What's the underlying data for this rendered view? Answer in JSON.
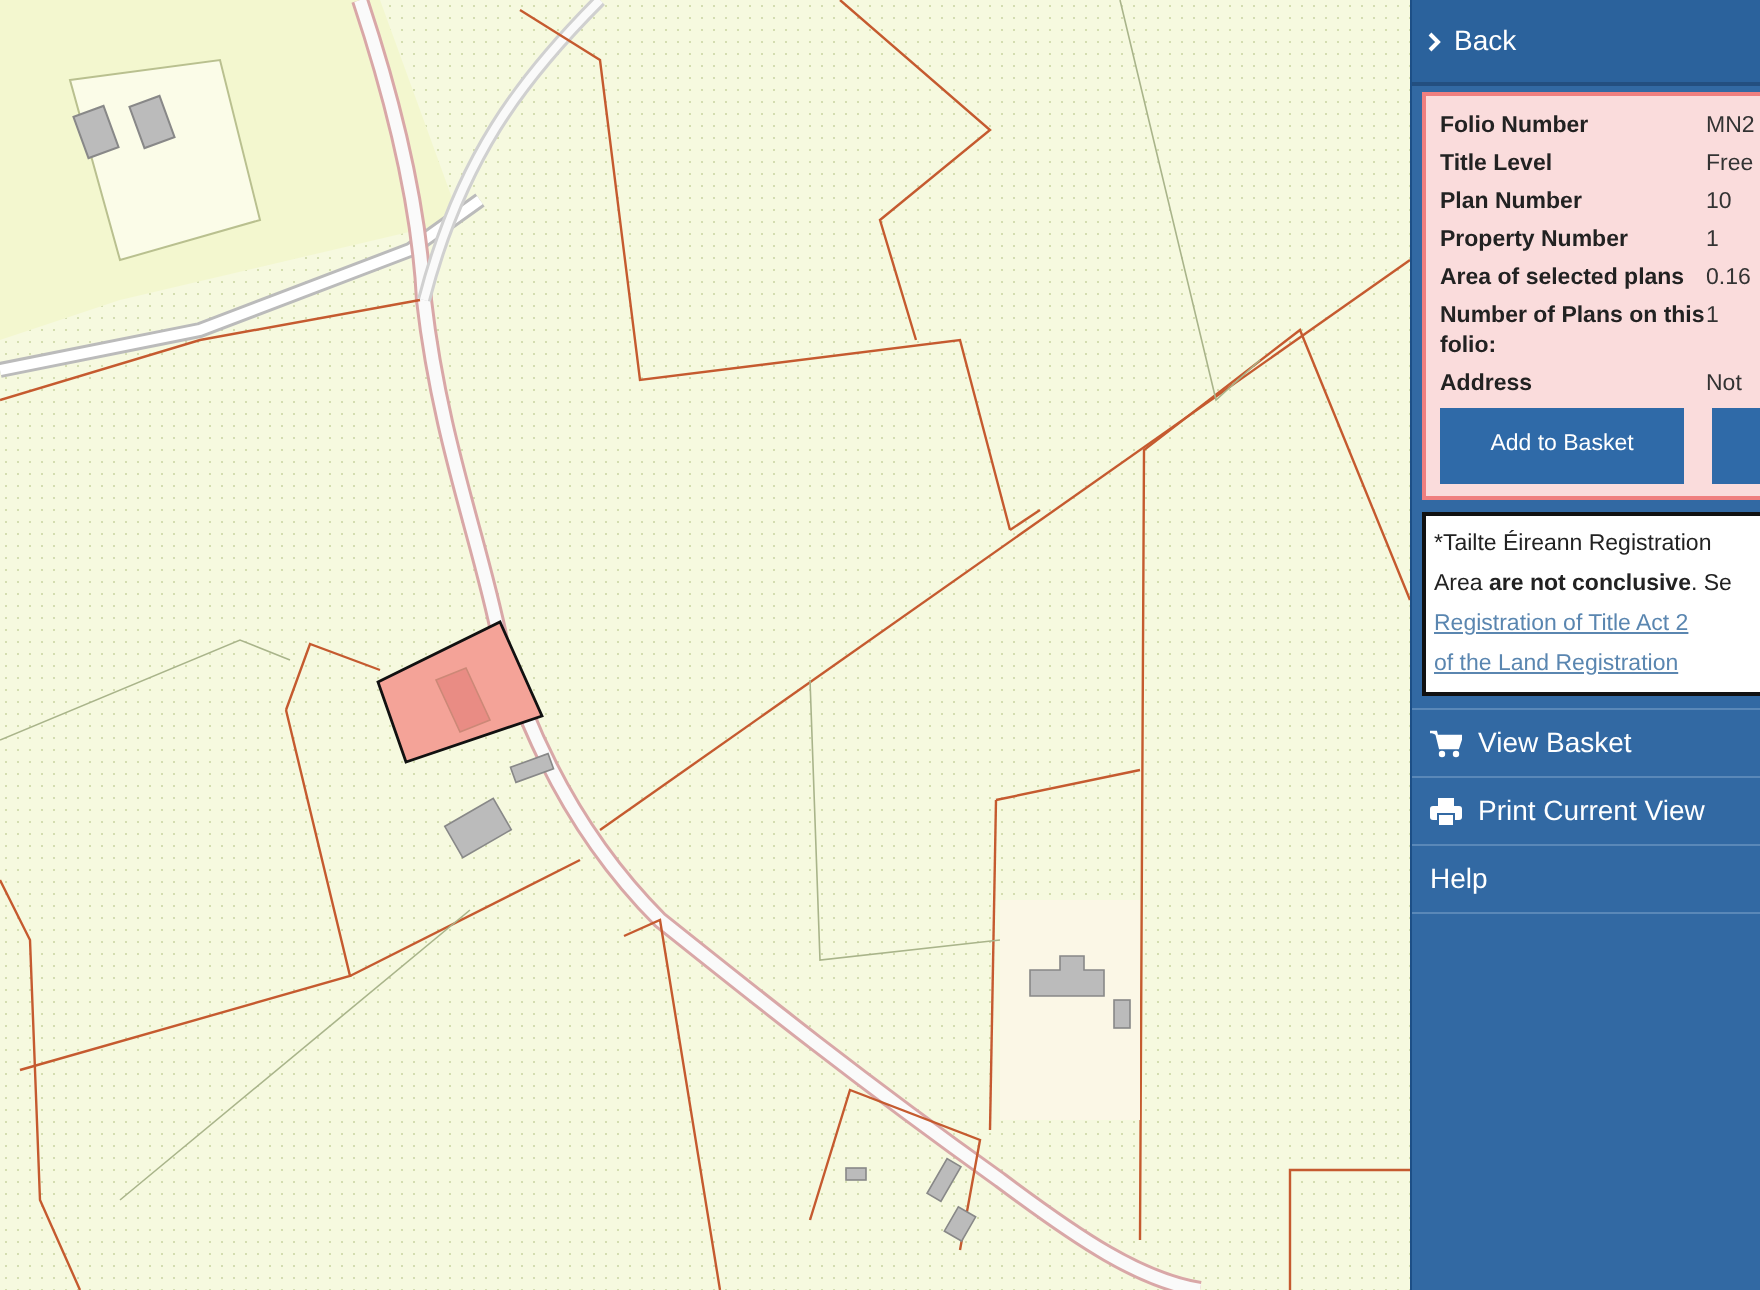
{
  "back": {
    "label": "Back"
  },
  "folio_details": {
    "rows": [
      {
        "label": "Folio Number",
        "value": "MN2"
      },
      {
        "label": "Title Level",
        "value": "Free"
      },
      {
        "label": "Plan Number",
        "value": "10"
      },
      {
        "label": "Property Number",
        "value": "1"
      },
      {
        "label": "Area of selected plans",
        "value": "0.16"
      },
      {
        "label": "Number of Plans on this folio:",
        "value": "1"
      },
      {
        "label": "Address",
        "value": "Not"
      }
    ],
    "buttons": [
      {
        "kind": "labelled",
        "label": "Add to Basket"
      },
      {
        "kind": "blank"
      }
    ]
  },
  "notice": {
    "lines": [
      {
        "kind": "text",
        "text": "*Tailte Éireann Registration"
      },
      {
        "kind": "text",
        "text": "Area **are not conclusive**. Se"
      },
      {
        "kind": "link",
        "text": "Registration of Title Act 2"
      },
      {
        "kind": "link",
        "text": "of the Land Registration"
      }
    ]
  },
  "menu": [
    {
      "kind": "cart",
      "label": "View Basket"
    },
    {
      "kind": "printer",
      "label": "Print Current View"
    },
    {
      "kind": "plain",
      "label": "Help"
    }
  ]
}
